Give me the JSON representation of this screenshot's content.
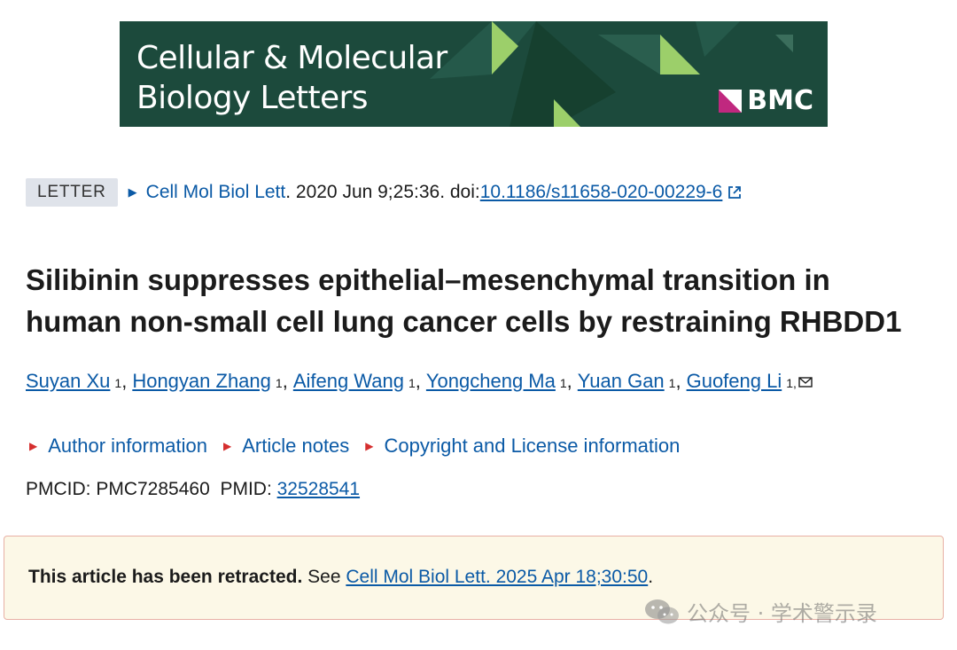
{
  "banner": {
    "title_line1": "Cellular & Molecular",
    "title_line2": "Biology Letters",
    "publisher": "BMC",
    "bg_color": "#1c4a3c",
    "accent_color": "#9ccf6a"
  },
  "citation": {
    "badge": "LETTER",
    "journal": "Cell Mol Biol Lett",
    "details": ". 2020 Jun 9;25:36. doi: ",
    "doi": "10.1186/s11658-020-00229-6",
    "external_icon": "external-link-icon"
  },
  "article": {
    "title": "Silibinin suppresses epithelial–mesenchymal transition in human non-small cell lung cancer cells by restraining RHBDD1"
  },
  "authors": [
    {
      "name": "Suyan Xu",
      "aff": "1"
    },
    {
      "name": "Hongyan Zhang",
      "aff": "1"
    },
    {
      "name": "Aifeng Wang",
      "aff": "1"
    },
    {
      "name": "Yongcheng Ma",
      "aff": "1"
    },
    {
      "name": "Yuan Gan",
      "aff": "1"
    },
    {
      "name": "Guofeng Li",
      "aff": "1,"
    }
  ],
  "author_separator": ",",
  "info_links": [
    {
      "label": "Author information"
    },
    {
      "label": "Article notes"
    },
    {
      "label": "Copyright and License information"
    }
  ],
  "ids": {
    "pmcid_label": "PMCID: PMC7285460",
    "pmid_label": "PMID: ",
    "pmid": "32528541"
  },
  "notice": {
    "bold_text": "This article has been retracted.",
    "see_text": " See ",
    "link_text": "Cell Mol Biol Lett. 2025 Apr 18;30:50",
    "end_text": "."
  },
  "watermark": {
    "text": "公众号 · 学术警示录",
    "icon": "wechat-icon"
  }
}
